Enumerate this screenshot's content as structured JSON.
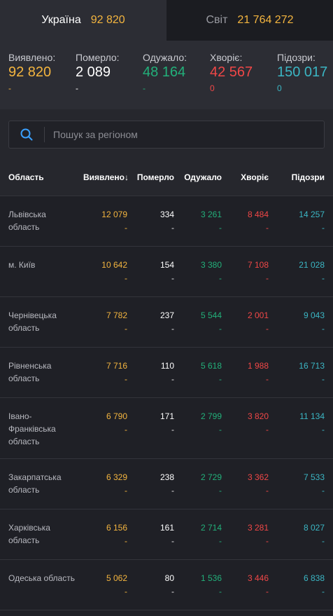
{
  "tabs": [
    {
      "label": "Україна",
      "value": "92 820"
    },
    {
      "label": "Світ",
      "value": "21 764 272"
    }
  ],
  "summary": {
    "detected": {
      "label": "Виявлено:",
      "value": "92 820",
      "delta": "-"
    },
    "died": {
      "label": "Померло:",
      "value": "2 089",
      "delta": "-"
    },
    "recovered": {
      "label": "Одужало:",
      "value": "48 164",
      "delta": "-"
    },
    "sick": {
      "label": "Хворіє:",
      "value": "42 567",
      "delta": "0"
    },
    "suspected": {
      "label": "Підозри:",
      "value": "150 017",
      "delta": "0"
    }
  },
  "search": {
    "placeholder": "Пошук за регіоном",
    "value": ""
  },
  "table": {
    "headers": {
      "region": "Область",
      "detected": "Виявлено",
      "sort_arrow": "↓",
      "died": "Померло",
      "recovered": "Одужало",
      "sick": "Хворіє",
      "suspected": "Підозри"
    },
    "rows": [
      {
        "region": [
          "Львівська",
          "область"
        ],
        "detected": "12 079",
        "died": "334",
        "recovered": "3 261",
        "sick": "8 484",
        "suspected": "14 257",
        "dash": "-"
      },
      {
        "region": [
          "м. Київ"
        ],
        "detected": "10 642",
        "died": "154",
        "recovered": "3 380",
        "sick": "7 108",
        "suspected": "21 028",
        "dash": "-"
      },
      {
        "region": [
          "Чернівецька",
          "область"
        ],
        "detected": "7 782",
        "died": "237",
        "recovered": "5 544",
        "sick": "2 001",
        "suspected": "9 043",
        "dash": "-"
      },
      {
        "region": [
          "Рівненська",
          "область"
        ],
        "detected": "7 716",
        "died": "110",
        "recovered": "5 618",
        "sick": "1 988",
        "suspected": "16 713",
        "dash": "-"
      },
      {
        "region": [
          "Івано-",
          "Франківська",
          "область"
        ],
        "detected": "6 790",
        "died": "171",
        "recovered": "2 799",
        "sick": "3 820",
        "suspected": "11 134",
        "dash": "-"
      },
      {
        "region": [
          "Закарпатська",
          "область"
        ],
        "detected": "6 329",
        "died": "238",
        "recovered": "2 729",
        "sick": "3 362",
        "suspected": "7 533",
        "dash": "-"
      },
      {
        "region": [
          "Харківська",
          "область"
        ],
        "detected": "6 156",
        "died": "161",
        "recovered": "2 714",
        "sick": "3 281",
        "suspected": "8 027",
        "dash": "-"
      },
      {
        "region": [
          "Одеська область"
        ],
        "detected": "5 062",
        "died": "80",
        "recovered": "1 536",
        "sick": "3 446",
        "suspected": "6 838",
        "dash": "-"
      }
    ]
  },
  "colors": {
    "detected": "#f4b53f",
    "died": "#ffffff",
    "recovered": "#22b07a",
    "sick": "#f04747",
    "suspected": "#3bb6c4"
  }
}
